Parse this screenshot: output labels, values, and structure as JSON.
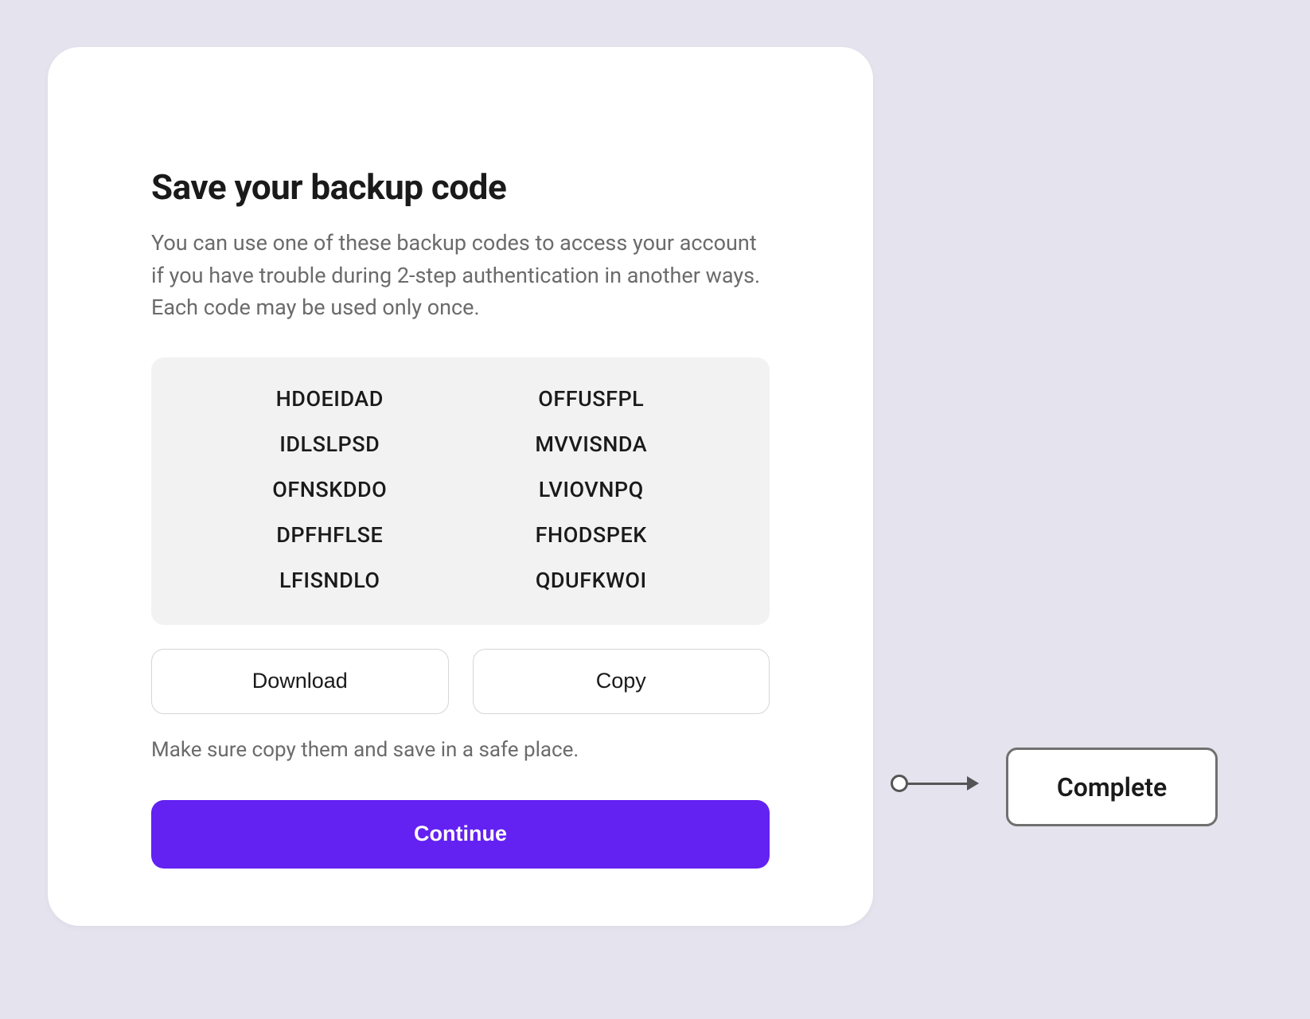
{
  "dialog": {
    "title": "Save your backup code",
    "description": "You can use one of these backup codes to access your account if you have trouble during 2-step authentication in another ways. Each code may be used only once.",
    "backup_codes": [
      "HDOEIDAD",
      "OFFUSFPL",
      "IDLSLPSD",
      "MVVISNDA",
      "OFNSKDDO",
      "LVIOVNPQ",
      "DPFHFLSE",
      "FHODSPEK",
      "LFISNDLO",
      "QDUFKWOI"
    ],
    "download_label": "Download",
    "copy_label": "Copy",
    "helper_text": "Make sure copy them and save in a safe place.",
    "continue_label": "Continue"
  },
  "flow": {
    "complete_label": "Complete"
  }
}
